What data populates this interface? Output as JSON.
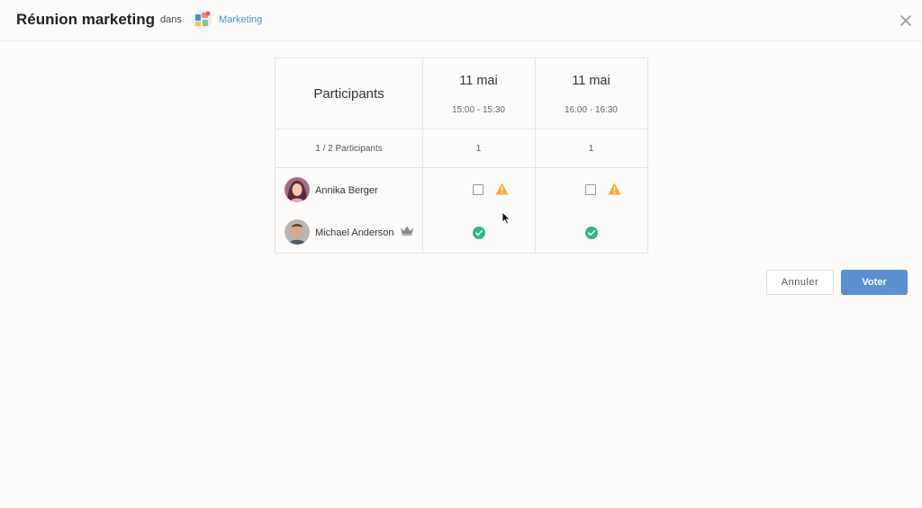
{
  "header": {
    "title": "Réunion marketing",
    "in_label": "dans",
    "space_name": "Marketing",
    "close_icon": "close-icon",
    "space_icon": "space-avatar-icon"
  },
  "poll": {
    "participants_header": "Participants",
    "participants_count": "1 / 2 Participants",
    "options": [
      {
        "date": "11 mai",
        "time": "15:00 - 15:30",
        "votes": "1"
      },
      {
        "date": "11 mai",
        "time": "16:00 - 16:30",
        "votes": "1"
      }
    ],
    "participants": [
      {
        "name": "Annika Berger",
        "is_owner": false,
        "answers": [
          "unchecked-with-warning",
          "unchecked-with-warning"
        ]
      },
      {
        "name": "Michael Anderson",
        "is_owner": true,
        "answers": [
          "accepted",
          "accepted"
        ]
      }
    ]
  },
  "actions": {
    "cancel_label": "Annuler",
    "vote_label": "Voter"
  },
  "colors": {
    "accent": "#5b8fcf",
    "link": "#4a8fd0",
    "warning": "#f0ac3a",
    "success": "#2fb58b"
  }
}
